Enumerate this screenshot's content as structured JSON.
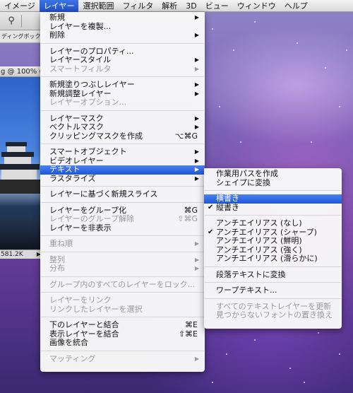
{
  "menubar": {
    "items": [
      {
        "label": "イメージ",
        "active": false
      },
      {
        "label": "レイヤー",
        "active": true
      },
      {
        "label": "選択範囲",
        "active": false
      },
      {
        "label": "フィルタ",
        "active": false
      },
      {
        "label": "解析",
        "active": false
      },
      {
        "label": "3D",
        "active": false
      },
      {
        "label": "ビュー",
        "active": false
      },
      {
        "label": "ウィンドウ",
        "active": false
      },
      {
        "label": "ヘルプ",
        "active": false
      }
    ]
  },
  "options_bar": {
    "text": "ディングボック..."
  },
  "document": {
    "title": "g @ 100% (",
    "status": "581.2K"
  },
  "layer_menu": {
    "items": [
      {
        "label": "新規",
        "submenu": true
      },
      {
        "label": "レイヤーを複製..."
      },
      {
        "label": "削除",
        "submenu": true
      },
      {
        "separator": true
      },
      {
        "label": "レイヤーのプロパティ..."
      },
      {
        "label": "レイヤースタイル",
        "submenu": true
      },
      {
        "label": "スマートフィルタ",
        "submenu": true,
        "disabled": true
      },
      {
        "separator": true
      },
      {
        "label": "新規塗りつぶしレイヤー",
        "submenu": true
      },
      {
        "label": "新規調整レイヤー",
        "submenu": true
      },
      {
        "label": "レイヤーオプション...",
        "disabled": true
      },
      {
        "separator": true
      },
      {
        "label": "レイヤーマスク",
        "submenu": true
      },
      {
        "label": "ベクトルマスク",
        "submenu": true
      },
      {
        "label": "クリッピングマスクを作成",
        "shortcut": "⌥⌘G"
      },
      {
        "separator": true
      },
      {
        "label": "スマートオブジェクト",
        "submenu": true
      },
      {
        "label": "ビデオレイヤー",
        "submenu": true
      },
      {
        "label": "テキスト",
        "submenu": true,
        "highlighted": true
      },
      {
        "label": "ラスタライズ",
        "submenu": true
      },
      {
        "separator": true
      },
      {
        "label": "レイヤーに基づく新規スライス"
      },
      {
        "separator": true
      },
      {
        "label": "レイヤーをグループ化",
        "shortcut": "⌘G"
      },
      {
        "label": "レイヤーのグループ解除",
        "shortcut": "⇧⌘G",
        "disabled": true
      },
      {
        "label": "レイヤーを非表示"
      },
      {
        "separator": true
      },
      {
        "label": "重ね順",
        "submenu": true,
        "disabled": true
      },
      {
        "separator": true
      },
      {
        "label": "整列",
        "submenu": true,
        "disabled": true
      },
      {
        "label": "分布",
        "submenu": true,
        "disabled": true
      },
      {
        "separator": true
      },
      {
        "label": "グループ内のすべてのレイヤーをロック...",
        "disabled": true
      },
      {
        "separator": true
      },
      {
        "label": "レイヤーをリンク",
        "disabled": true
      },
      {
        "label": "リンクしたレイヤーを選択",
        "disabled": true
      },
      {
        "separator": true
      },
      {
        "label": "下のレイヤーと結合",
        "shortcut": "⌘E"
      },
      {
        "label": "表示レイヤーを結合",
        "shortcut": "⇧⌘E"
      },
      {
        "label": "画像を統合"
      },
      {
        "separator": true
      },
      {
        "label": "マッティング",
        "submenu": true,
        "disabled": true
      }
    ]
  },
  "text_submenu": {
    "items": [
      {
        "label": "作業用パスを作成"
      },
      {
        "label": "シェイプに変換"
      },
      {
        "separator": true
      },
      {
        "label": "横書き",
        "highlighted": true
      },
      {
        "label": "縦書き",
        "checked": true
      },
      {
        "separator": true
      },
      {
        "label": "アンチエイリアス (なし)"
      },
      {
        "label": "アンチエイリアス (シャープ)",
        "checked": true
      },
      {
        "label": "アンチエイリアス (鮮明)"
      },
      {
        "label": "アンチエイリアス (強く)"
      },
      {
        "label": "アンチエイリアス (滑らかに)"
      },
      {
        "separator": true
      },
      {
        "label": "段落テキストに変換"
      },
      {
        "separator": true
      },
      {
        "label": "ワープテキスト..."
      },
      {
        "separator": true
      },
      {
        "label": "すべてのテキストレイヤーを更新",
        "disabled": true
      },
      {
        "label": "見つからないフォントの置き換え",
        "disabled": true
      }
    ]
  },
  "glyphs": {
    "submenu_arrow": "▶",
    "checkmark": "✔"
  },
  "icons": {
    "tool": "eyedropper-icon",
    "status_arrow": "triangle-right-icon"
  }
}
